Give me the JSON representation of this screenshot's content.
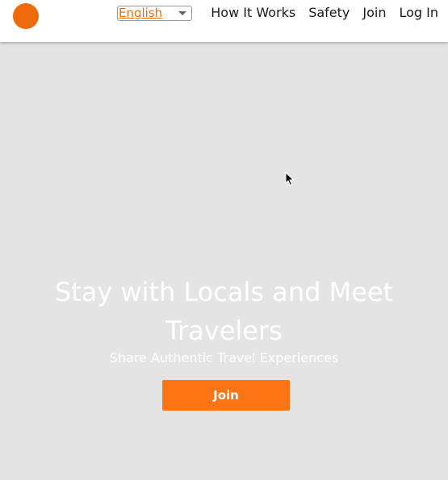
{
  "header": {
    "language_select": {
      "value": "English"
    },
    "nav": {
      "how_it_works": "How It Works",
      "safety": "Safety",
      "join": "Join",
      "log_in": "Log In"
    }
  },
  "hero": {
    "title": "Stay with Locals and Meet Travelers",
    "subtitle": "Share Authentic Travel Experiences",
    "cta_label": "Join"
  },
  "colors": {
    "brand_orange": "#ee6a0d",
    "button_orange": "#fb7515",
    "hero_background": "#e4e4e4"
  },
  "icons": {
    "logo": "circle-logo",
    "dropdown": "chevron-down-icon",
    "cursor": "arrow-cursor-icon"
  }
}
